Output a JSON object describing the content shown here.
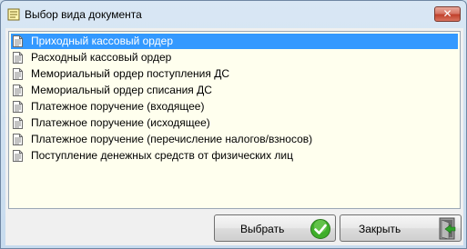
{
  "window": {
    "title": "Выбор вида документа",
    "close_glyph": "✕",
    "icon": "document-list-icon"
  },
  "list": {
    "selected_index": 0,
    "items": [
      {
        "label": "Приходный кассовый ордер"
      },
      {
        "label": "Расходный кассовый ордер"
      },
      {
        "label": "Мемориальный ордер поступления ДС"
      },
      {
        "label": "Мемориальный ордер списания ДС"
      },
      {
        "label": "Платежное поручение (входящее)"
      },
      {
        "label": "Платежное поручение (исходящее)"
      },
      {
        "label": "Платежное поручение (перечисление налогов/взносов)"
      },
      {
        "label": "Поступление денежных средств от физических лиц"
      }
    ],
    "item_icon": "document-icon"
  },
  "buttons": {
    "select_label": "Выбрать",
    "select_icon": "checkmark-icon",
    "close_label": "Закрыть",
    "close_icon": "exit-door-icon"
  },
  "colors": {
    "selection": "#3399ff",
    "list_background": "#ffffee",
    "close_button": "#c1412c"
  }
}
